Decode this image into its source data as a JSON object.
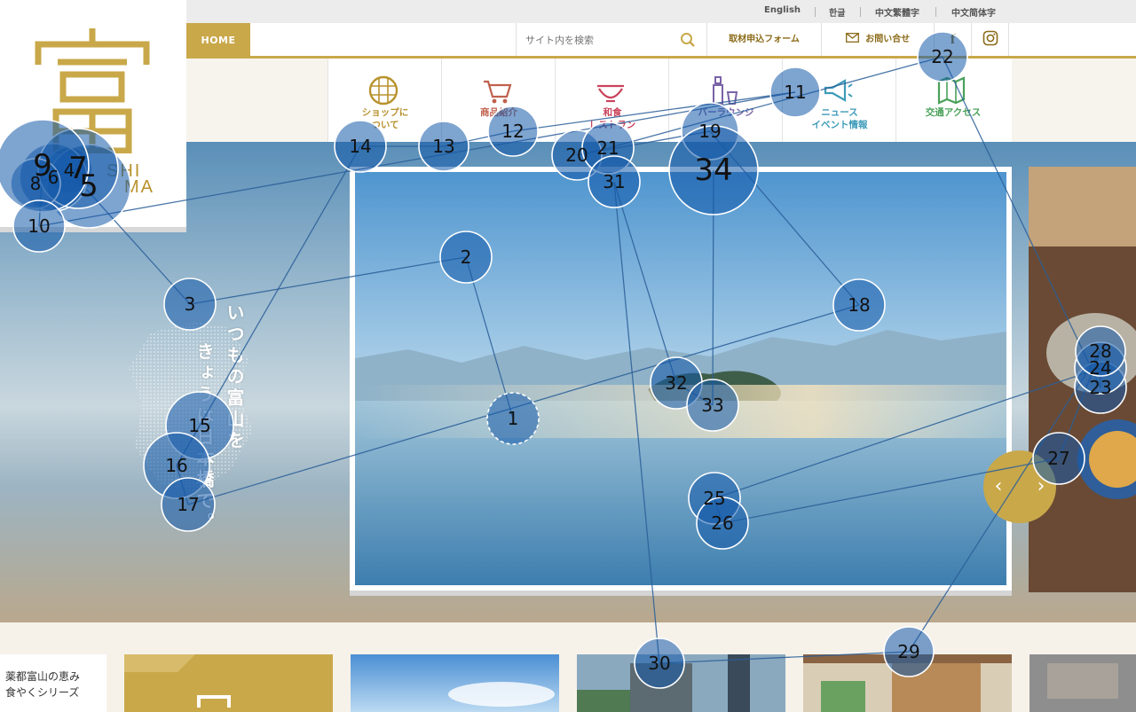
{
  "languages": [
    "English",
    "한글",
    "中文繁體字",
    "中文简体字"
  ],
  "header": {
    "home_label": "HOME",
    "search_placeholder": "サイト内を検索",
    "press_label": "取材申込フォーム",
    "contact_label": "お問い合せ"
  },
  "logo": {
    "glyph": "富",
    "word1": "SHI",
    "word2": "MA"
  },
  "nav": [
    {
      "label": "ショップに\nついて",
      "color": "#b8922e",
      "icon": "globe-icon"
    },
    {
      "label": "商品紹介",
      "color": "#c0604c",
      "icon": "cart-icon"
    },
    {
      "label": "和食\nレストラン",
      "color": "#c9445c",
      "icon": "bowl-icon"
    },
    {
      "label": "バーラウンジ",
      "color": "#7a63a6",
      "icon": "bottle-icon"
    },
    {
      "label": "ニュース\nイベント情報",
      "color": "#3d9bb8",
      "icon": "megaphone-icon"
    },
    {
      "label": "交通アクセス",
      "color": "#4aa15a",
      "icon": "map-icon"
    }
  ],
  "hero": {
    "line1": "いつもの富山を",
    "line2": "きょうは日本橋で。"
  },
  "slider": {
    "prev": "‹",
    "next": "›"
  },
  "bottom": {
    "promo": "薬都富山の恵み\n食やくシリーズ"
  },
  "fixations": [
    {
      "n": "1",
      "dashed": true
    },
    {
      "n": "2"
    },
    {
      "n": "3"
    },
    {
      "n": "4"
    },
    {
      "n": "5"
    },
    {
      "n": "6"
    },
    {
      "n": "7"
    },
    {
      "n": "8"
    },
    {
      "n": "9"
    },
    {
      "n": "10"
    },
    {
      "n": "11"
    },
    {
      "n": "12"
    },
    {
      "n": "13"
    },
    {
      "n": "14"
    },
    {
      "n": "15"
    },
    {
      "n": "16"
    },
    {
      "n": "17"
    },
    {
      "n": "18"
    },
    {
      "n": "19"
    },
    {
      "n": "20"
    },
    {
      "n": "21"
    },
    {
      "n": "22"
    },
    {
      "n": "23"
    },
    {
      "n": "24"
    },
    {
      "n": "25"
    },
    {
      "n": "26"
    },
    {
      "n": "27"
    },
    {
      "n": "28"
    },
    {
      "n": "29"
    },
    {
      "n": "30"
    },
    {
      "n": "31"
    },
    {
      "n": "32"
    },
    {
      "n": "33"
    },
    {
      "n": "34"
    }
  ]
}
